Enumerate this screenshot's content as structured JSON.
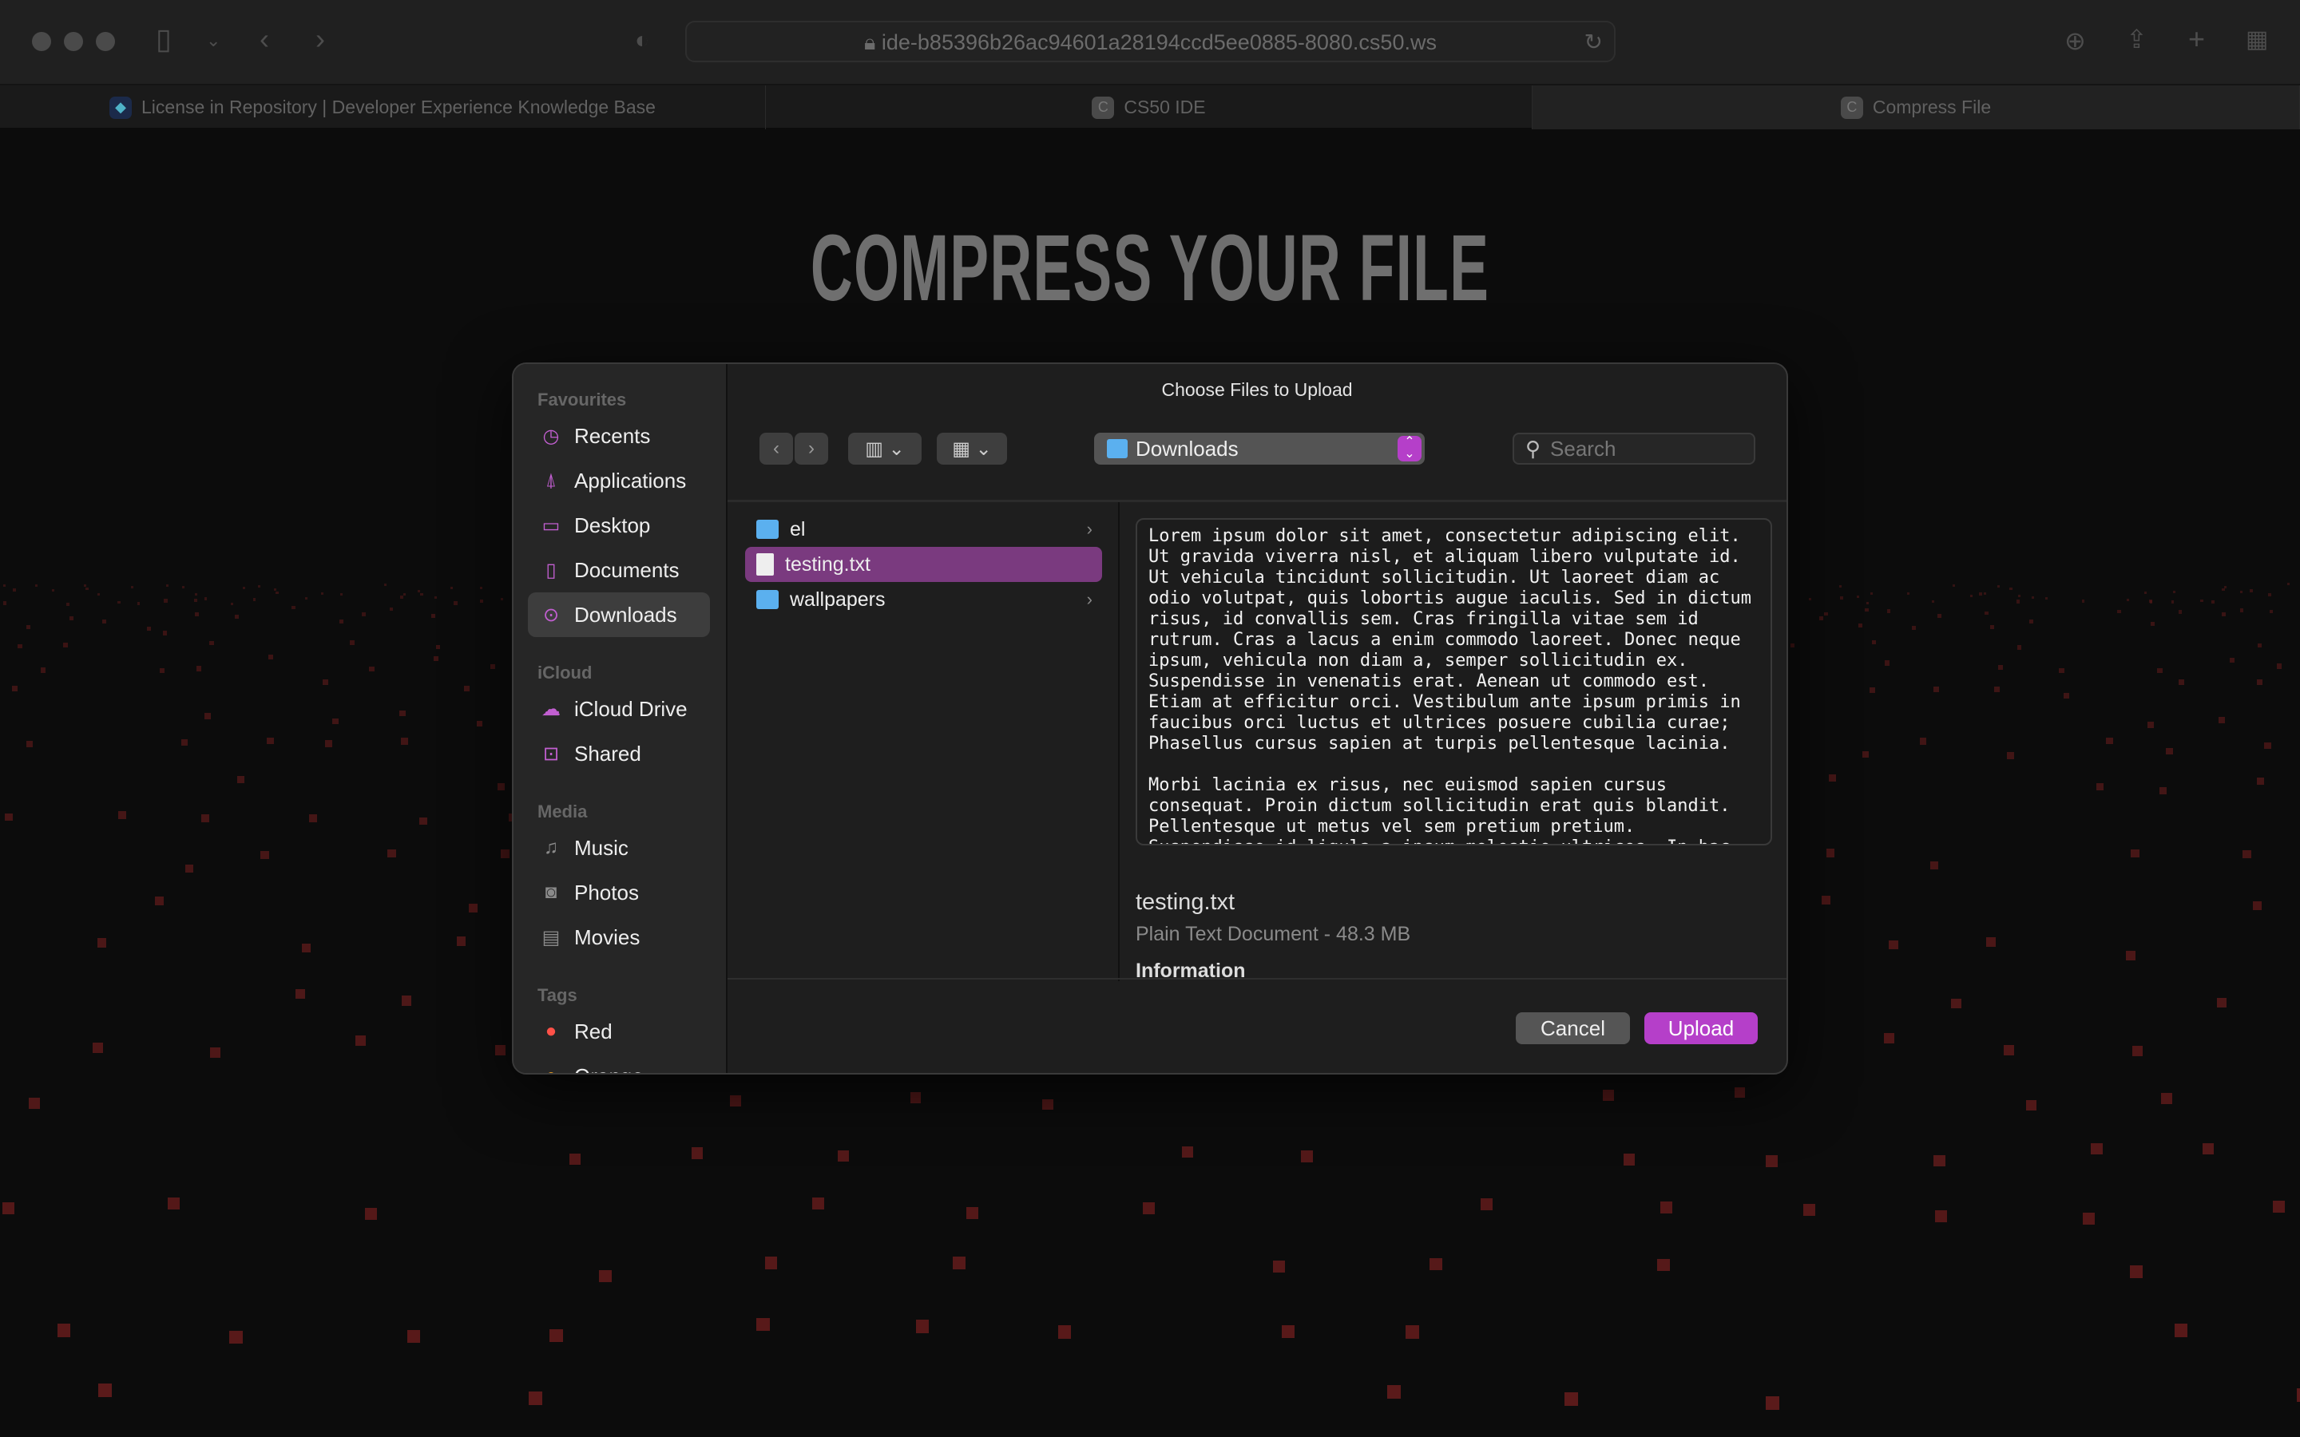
{
  "browser": {
    "url": "ide-b85396b26ac94601a28194ccd5ee0885-8080.cs50.ws",
    "tabs": [
      {
        "title": "License in Repository | Developer Experience Knowledge Base",
        "icon": "diamond-icon"
      },
      {
        "title": "CS50 IDE",
        "icon": "C"
      },
      {
        "title": "Compress File",
        "icon": "C",
        "active": true
      }
    ]
  },
  "page": {
    "title": "COMPRESS YOUR FILE",
    "dot_color": "#5a1a1a"
  },
  "dialog": {
    "title": "Choose Files to Upload",
    "location": "Downloads",
    "search_placeholder": "Search",
    "sidebar": {
      "favourites_label": "Favourites",
      "favourites": [
        {
          "label": "Recents",
          "icon": "clock-icon"
        },
        {
          "label": "Applications",
          "icon": "apps-icon"
        },
        {
          "label": "Desktop",
          "icon": "desktop-icon"
        },
        {
          "label": "Documents",
          "icon": "document-icon"
        },
        {
          "label": "Downloads",
          "icon": "download-icon",
          "selected": true
        }
      ],
      "icloud_label": "iCloud",
      "icloud": [
        {
          "label": "iCloud Drive",
          "icon": "cloud-icon"
        },
        {
          "label": "Shared",
          "icon": "shared-folder-icon"
        }
      ],
      "media_label": "Media",
      "media": [
        {
          "label": "Music",
          "icon": "music-icon"
        },
        {
          "label": "Photos",
          "icon": "camera-icon"
        },
        {
          "label": "Movies",
          "icon": "film-icon"
        }
      ],
      "tags_label": "Tags",
      "tags": [
        {
          "label": "Red",
          "color": "#ff5148"
        },
        {
          "label": "Orange",
          "color": "#f5a623"
        }
      ]
    },
    "files": [
      {
        "name": "el",
        "type": "folder"
      },
      {
        "name": "testing.txt",
        "type": "file",
        "selected": true
      },
      {
        "name": "wallpapers",
        "type": "folder"
      }
    ],
    "preview_lines": [
      "Lorem ipsum dolor sit amet, consectetur adipiscing elit.",
      "Ut gravida viverra nisl, et aliquam libero vulputate id.",
      "Ut vehicula tincidunt sollicitudin. Ut laoreet diam ac",
      "odio volutpat, quis lobortis augue iaculis. Sed in dictum",
      "risus, id convallis sem. Cras fringilla vitae sem id",
      "rutrum. Cras a lacus a enim commodo laoreet. Donec neque",
      "ipsum, vehicula non diam a, semper sollicitudin ex.",
      "Suspendisse in venenatis erat. Aenean ut commodo est.",
      "Etiam at efficitur orci. Vestibulum ante ipsum primis in",
      "faucibus orci luctus et ultrices posuere cubilia curae;",
      "Phasellus cursus sapien at turpis pellentesque lacinia.",
      "",
      "Morbi lacinia ex risus, nec euismod sapien cursus",
      "consequat. Proin dictum sollicitudin erat quis blandit.",
      "Pellentesque ut metus vel sem pretium pretium.",
      "Suspendisse id ligula a ipsum molestie ultrices. In hac"
    ],
    "selected_name": "testing.txt",
    "selected_desc": "Plain Text Document - 48.3 MB",
    "info_label": "Information",
    "cancel_label": "Cancel",
    "upload_label": "Upload",
    "accent": "#b53fc9"
  }
}
